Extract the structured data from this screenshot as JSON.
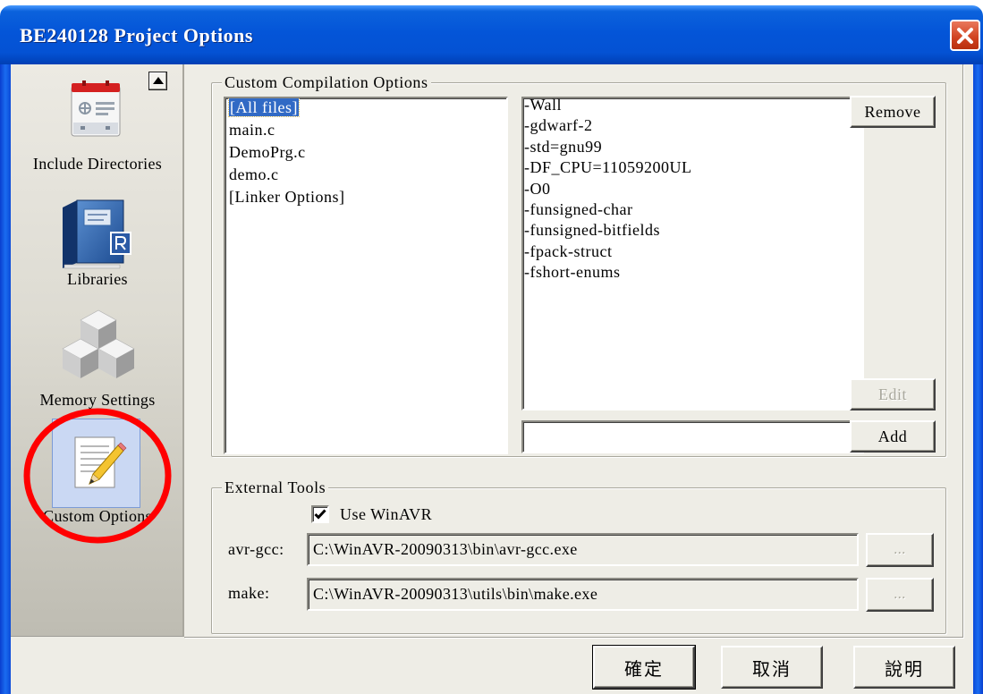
{
  "window": {
    "title": "BE240128 Project Options",
    "close_icon": "close-icon"
  },
  "colors": {
    "title_bar": "#0455d8",
    "selection": "#316ac5",
    "close_button": "#d0421f",
    "annotation_circle": "#ff0000"
  },
  "sidebar": {
    "scroll_up_icon": "scroll-up-arrow-icon",
    "items": [
      {
        "label": "Include Directories",
        "icon": "include-directories-icon",
        "selected": false
      },
      {
        "label": "Libraries",
        "icon": "libraries-book-icon",
        "selected": false
      },
      {
        "label": "Memory Settings",
        "icon": "memory-settings-cubes-icon",
        "selected": false
      },
      {
        "label": "Custom Options",
        "icon": "custom-options-notepad-icon",
        "selected": true
      }
    ]
  },
  "custom_compilation": {
    "group_label": "Custom Compilation Options",
    "files": [
      {
        "name": "[All files]",
        "selected": true
      },
      {
        "name": "main.c",
        "selected": false
      },
      {
        "name": "DemoPrg.c",
        "selected": false
      },
      {
        "name": "demo.c",
        "selected": false
      },
      {
        "name": "[Linker Options]",
        "selected": false
      }
    ],
    "options": [
      "-Wall",
      "-gdwarf-2",
      "-std=gnu99",
      "-DF_CPU=11059200UL",
      "-O0",
      "-funsigned-char",
      "-funsigned-bitfields",
      "-fpack-struct",
      "-fshort-enums"
    ],
    "new_option_value": "",
    "remove_label": "Remove",
    "edit_label": "Edit",
    "edit_enabled": false,
    "add_label": "Add"
  },
  "external_tools": {
    "group_label": "External Tools",
    "use_winavr": {
      "label": "Use WinAVR",
      "checked": true
    },
    "avr_gcc": {
      "label": "avr-gcc:",
      "path": "C:\\WinAVR-20090313\\bin\\avr-gcc.exe",
      "browse_label": "...",
      "enabled": false
    },
    "make": {
      "label": "make:",
      "path": "C:\\WinAVR-20090313\\utils\\bin\\make.exe",
      "browse_label": "...",
      "enabled": false
    }
  },
  "footer": {
    "ok_label": "確定",
    "cancel_label": "取消",
    "help_label": "說明"
  }
}
